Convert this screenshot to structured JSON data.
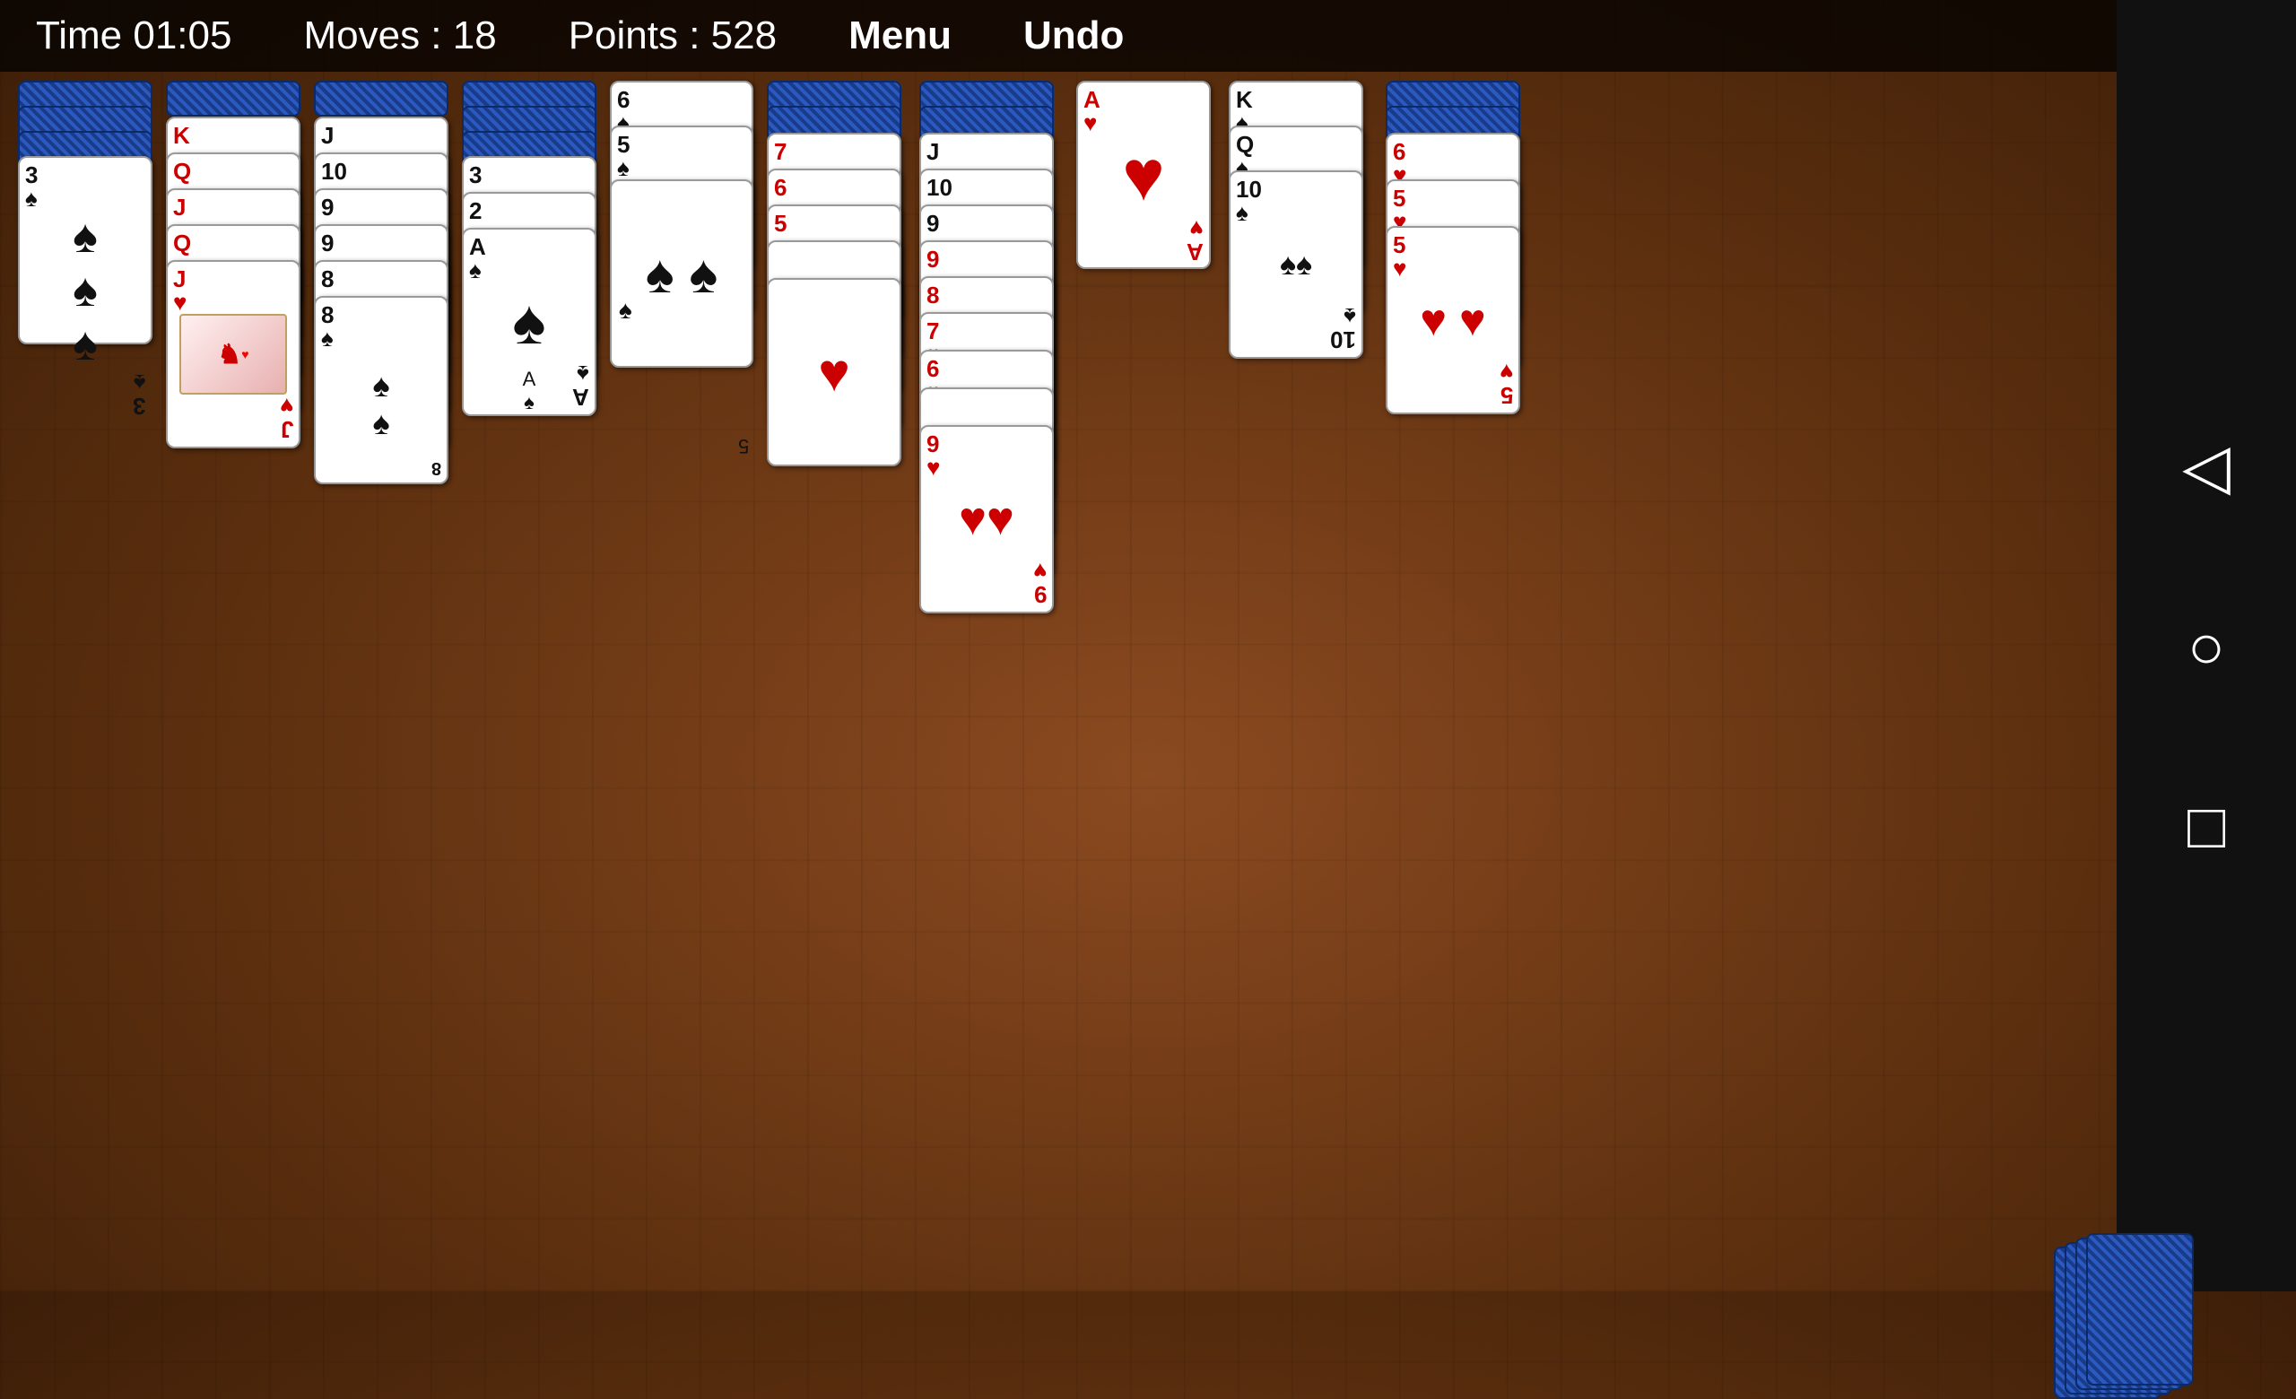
{
  "header": {
    "time_label": "Time 01:05",
    "moves_label": "Moves : 18",
    "points_label": "Points : 528",
    "menu_label": "Menu",
    "undo_label": "Undo"
  },
  "nav": {
    "back_icon": "◁",
    "circle_icon": "○",
    "square_icon": "□"
  },
  "columns": [
    {
      "id": "col1",
      "cards": [
        {
          "type": "back",
          "stacked": true,
          "offset": 0
        },
        {
          "type": "back",
          "stacked": true,
          "offset": 30
        },
        {
          "type": "back",
          "stacked": true,
          "offset": 60
        },
        {
          "type": "face",
          "value": "3",
          "suit": "♠",
          "color": "black",
          "offset": 90,
          "face_type": "number"
        }
      ]
    },
    {
      "id": "col2",
      "cards": [
        {
          "type": "back",
          "stacked": true,
          "offset": 0
        },
        {
          "type": "face",
          "value": "K",
          "suit": "♥",
          "color": "red",
          "offset": 40,
          "face_type": "king-hearts"
        },
        {
          "type": "face",
          "value": "Q",
          "suit": "♥",
          "color": "red",
          "offset": 80,
          "face_type": "queen-hearts"
        },
        {
          "type": "face",
          "value": "J",
          "suit": "♥",
          "color": "red",
          "offset": 120,
          "face_type": "jack-hearts"
        },
        {
          "type": "face",
          "value": "Q",
          "suit": "♥",
          "color": "red",
          "offset": 160,
          "face_type": "queen-hearts2"
        },
        {
          "type": "face",
          "value": "J",
          "suit": "♥",
          "color": "red",
          "offset": 200,
          "face_type": "jack-hearts2"
        }
      ]
    },
    {
      "id": "col3",
      "cards": [
        {
          "type": "back",
          "stacked": true,
          "offset": 0
        },
        {
          "type": "face",
          "value": "J",
          "suit": "♠",
          "color": "black",
          "offset": 40,
          "face_type": "jack-spades"
        },
        {
          "type": "face",
          "value": "10",
          "suit": "♠",
          "color": "black",
          "offset": 80,
          "face_type": "number"
        },
        {
          "type": "face",
          "value": "9",
          "suit": "♠",
          "color": "black",
          "offset": 120,
          "face_type": "number"
        },
        {
          "type": "face",
          "value": "9",
          "suit": "♠",
          "color": "black",
          "offset": 160,
          "face_type": "number"
        },
        {
          "type": "face",
          "value": "8",
          "suit": "♠",
          "color": "black",
          "offset": 200,
          "face_type": "number"
        },
        {
          "type": "face",
          "value": "8",
          "suit": "♠",
          "color": "black",
          "offset": 240,
          "face_type": "number"
        }
      ]
    },
    {
      "id": "col4",
      "cards": [
        {
          "type": "back",
          "stacked": true,
          "offset": 0
        },
        {
          "type": "back",
          "stacked": true,
          "offset": 30
        },
        {
          "type": "back",
          "stacked": true,
          "offset": 60
        },
        {
          "type": "face",
          "value": "3",
          "suit": "♠",
          "color": "black",
          "offset": 90,
          "face_type": "number"
        },
        {
          "type": "face",
          "value": "2",
          "suit": "♠",
          "color": "black",
          "offset": 130,
          "face_type": "number"
        },
        {
          "type": "face",
          "value": "A",
          "suit": "♠",
          "color": "black",
          "offset": 170,
          "face_type": "number"
        },
        {
          "type": "face",
          "value": "A",
          "suit": "♠",
          "color": "black",
          "offset": 210,
          "face_type": "number-small"
        }
      ]
    },
    {
      "id": "col5",
      "cards": [
        {
          "type": "face",
          "value": "6",
          "suit": "♠",
          "color": "black",
          "offset": 0,
          "face_type": "number"
        },
        {
          "type": "face",
          "value": "5",
          "suit": "♠",
          "color": "black",
          "offset": 50,
          "face_type": "number"
        },
        {
          "type": "face",
          "value": "5",
          "suit": "♠",
          "color": "black",
          "offset": 100,
          "face_type": "number-pair"
        },
        {
          "type": "face",
          "value": "5",
          "suit": "♠",
          "color": "black",
          "offset": 150,
          "face_type": "number-bot"
        }
      ]
    },
    {
      "id": "col6",
      "cards": [
        {
          "type": "back",
          "stacked": true,
          "offset": 0
        },
        {
          "type": "back",
          "stacked": true,
          "offset": 30
        },
        {
          "type": "face",
          "value": "7",
          "suit": "♥",
          "color": "red",
          "offset": 60,
          "face_type": "number"
        },
        {
          "type": "face",
          "value": "6",
          "suit": "♥",
          "color": "red",
          "offset": 100,
          "face_type": "number"
        },
        {
          "type": "face",
          "value": "5",
          "suit": "♥",
          "color": "red",
          "offset": 140,
          "face_type": "number"
        },
        {
          "type": "face",
          "value": "5",
          "suit": "♥",
          "color": "red",
          "offset": 180,
          "face_type": "number-pair"
        },
        {
          "type": "face",
          "value": "♥",
          "suit": "♥",
          "color": "red",
          "offset": 220,
          "face_type": "heart-center"
        },
        {
          "type": "face",
          "value": "♥♥",
          "suit": "♥",
          "color": "red",
          "offset": 260,
          "face_type": "heart-pair"
        }
      ]
    },
    {
      "id": "col7",
      "cards": [
        {
          "type": "back",
          "stacked": true,
          "offset": 0
        },
        {
          "type": "back",
          "stacked": true,
          "offset": 30
        },
        {
          "type": "face",
          "value": "J",
          "suit": "♠",
          "color": "black",
          "offset": 60,
          "face_type": "jack-spades2"
        },
        {
          "type": "face",
          "value": "10",
          "suit": "♠",
          "color": "black",
          "offset": 100,
          "face_type": "number"
        },
        {
          "type": "face",
          "value": "9",
          "suit": "♠",
          "color": "black",
          "offset": 140,
          "face_type": "number"
        },
        {
          "type": "face",
          "value": "9",
          "suit": "♥",
          "color": "red",
          "offset": 180,
          "face_type": "number"
        },
        {
          "type": "face",
          "value": "8",
          "suit": "♥",
          "color": "red",
          "offset": 220,
          "face_type": "number"
        },
        {
          "type": "face",
          "value": "7",
          "suit": "♥",
          "color": "red",
          "offset": 260,
          "face_type": "number"
        },
        {
          "type": "face",
          "value": "6",
          "suit": "♥",
          "color": "red",
          "offset": 300,
          "face_type": "number"
        },
        {
          "type": "face",
          "value": "♥♥",
          "suit": "♥",
          "color": "red",
          "offset": 340,
          "face_type": "number"
        },
        {
          "type": "face",
          "value": "9",
          "suit": "♥",
          "color": "red",
          "offset": 380,
          "face_type": "number-bot"
        }
      ]
    },
    {
      "id": "col8",
      "cards": [
        {
          "type": "face",
          "value": "A",
          "suit": "♥",
          "color": "red",
          "offset": 0,
          "face_type": "ace-hearts"
        }
      ]
    },
    {
      "id": "col9",
      "cards": [
        {
          "type": "face",
          "value": "K",
          "suit": "♠",
          "color": "black",
          "offset": 0,
          "face_type": "king-spades"
        },
        {
          "type": "face",
          "value": "Q",
          "suit": "♠",
          "color": "black",
          "offset": 50,
          "face_type": "queen-spades"
        },
        {
          "type": "face",
          "value": "10",
          "suit": "♠",
          "color": "black",
          "offset": 100,
          "face_type": "number-bot"
        }
      ]
    },
    {
      "id": "col10",
      "cards": [
        {
          "type": "back",
          "stacked": true,
          "offset": 0
        },
        {
          "type": "back",
          "stacked": true,
          "offset": 30
        },
        {
          "type": "face",
          "value": "6",
          "suit": "♥",
          "color": "red",
          "offset": 60,
          "face_type": "number"
        },
        {
          "type": "face",
          "value": "5",
          "suit": "♥",
          "color": "red",
          "offset": 110,
          "face_type": "number"
        },
        {
          "type": "face",
          "value": "5",
          "suit": "♥",
          "color": "red",
          "offset": 160,
          "face_type": "number-bot"
        }
      ]
    }
  ]
}
